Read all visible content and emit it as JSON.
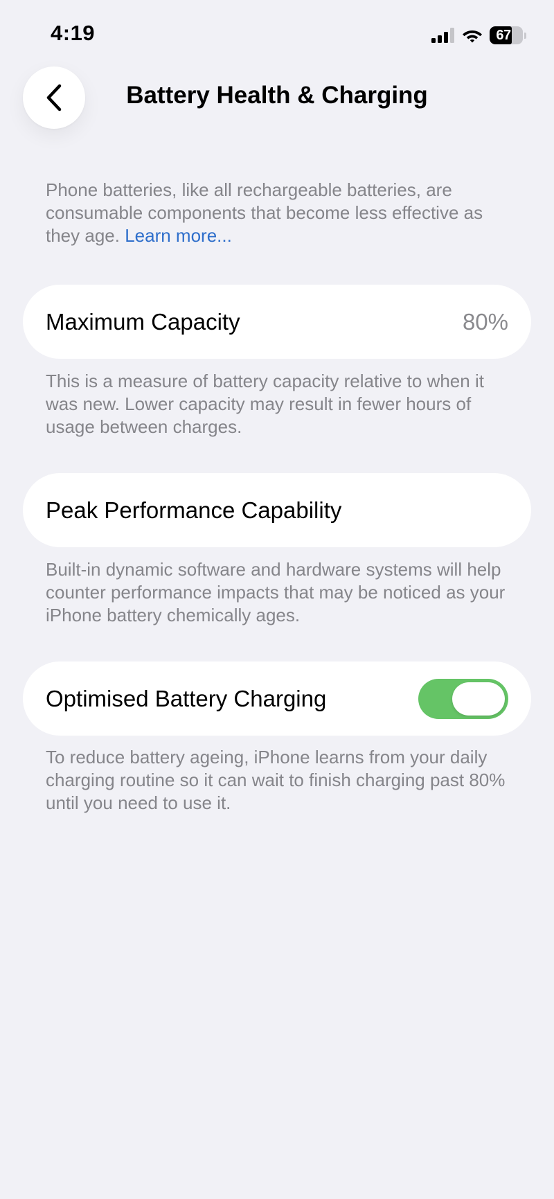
{
  "status_bar": {
    "time": "4:19",
    "battery_level": "67",
    "battery_percent": 67,
    "signal_bars_active": 3,
    "signal_bars_total": 4
  },
  "nav": {
    "back_icon": "chevron-left-icon",
    "title": "Battery Health & Charging"
  },
  "intro": {
    "text": "Phone batteries, like all rechargeable batteries, are consumable components that become less effective as they age. ",
    "link": "Learn more..."
  },
  "maximum_capacity": {
    "label": "Maximum Capacity",
    "value": "80%",
    "footnote": "This is a measure of battery capacity relative to when it was new. Lower capacity may result in fewer hours of usage between charges."
  },
  "peak_performance": {
    "label": "Peak Performance Capability",
    "footnote": "Built-in dynamic software and hardware systems will help counter performance impacts that may be noticed as your iPhone battery chemically ages."
  },
  "optimised_charging": {
    "label": "Optimised Battery Charging",
    "enabled": true,
    "footnote": "To reduce battery ageing, iPhone learns from your daily charging routine so it can wait to finish charging past 80% until you need to use it."
  },
  "colors": {
    "background": "#f1f1f6",
    "cell": "#ffffff",
    "secondary_text": "#85858a",
    "link": "#2f6fcb",
    "toggle_on": "#65c466"
  }
}
